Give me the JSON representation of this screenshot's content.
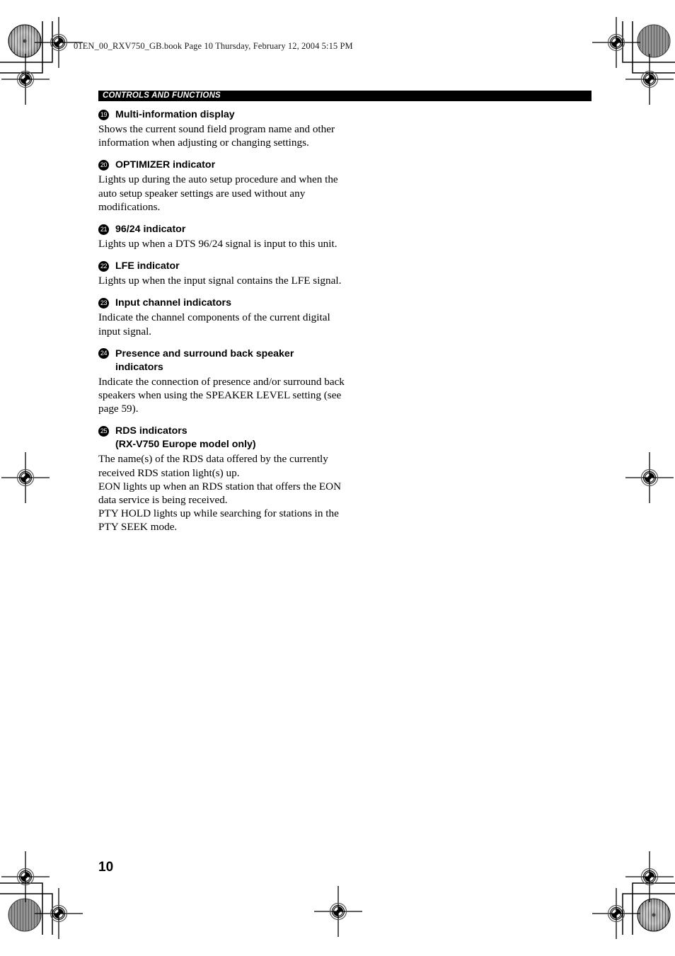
{
  "page": {
    "file_line": "01EN_00_RXV750_GB.book  Page 10  Thursday, February 12, 2004  5:15 PM",
    "section_title": "CONTROLS AND FUNCTIONS",
    "folio": "10",
    "background_color": "#ffffff",
    "text_color": "#000000",
    "bar_color": "#000000",
    "bar_text_color": "#ffffff"
  },
  "entries": [
    {
      "number": "19",
      "heading": "Multi-information display",
      "heading_cont": "",
      "body": "Shows the current sound field program name and other information when adjusting or changing settings."
    },
    {
      "number": "20",
      "heading": "OPTIMIZER indicator",
      "heading_cont": "",
      "body": "Lights up during the auto setup procedure and when the auto setup speaker settings are used without any modifications."
    },
    {
      "number": "21",
      "heading": "96/24 indicator",
      "heading_cont": "",
      "body": "Lights up when a DTS 96/24 signal is input to this unit."
    },
    {
      "number": "22",
      "heading": "LFE indicator",
      "heading_cont": "",
      "body": "Lights up when the input signal contains the LFE signal."
    },
    {
      "number": "23",
      "heading": "Input channel indicators",
      "heading_cont": "",
      "body": "Indicate the channel components of the current digital input signal."
    },
    {
      "number": "24",
      "heading": "Presence and surround back speaker",
      "heading_cont": "indicators",
      "body": "Indicate the connection of presence and/or surround back speakers when using the SPEAKER LEVEL setting (see page 59)."
    },
    {
      "number": "25",
      "heading": "RDS indicators",
      "heading_cont": "(RX-V750 Europe model only)",
      "body": "The name(s) of the RDS data offered by the currently received RDS station light(s) up.",
      "body2": "EON lights up when an RDS station that offers the EON data service is being received.",
      "body3": "PTY HOLD lights up while searching for stations in the PTY SEEK mode."
    }
  ]
}
